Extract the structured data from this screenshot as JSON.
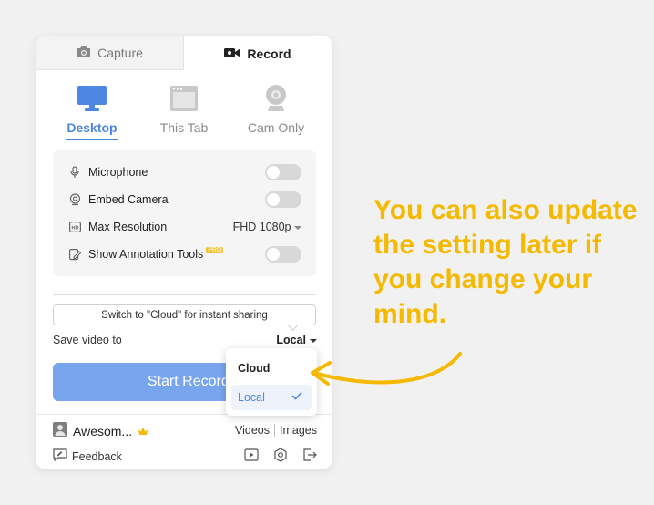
{
  "tabs": {
    "capture_label": "Capture",
    "record_label": "Record"
  },
  "modes": [
    {
      "label": "Desktop",
      "icon": "monitor-icon",
      "selected": true
    },
    {
      "label": "This Tab",
      "icon": "browser-tab-icon",
      "selected": false
    },
    {
      "label": "Cam Only",
      "icon": "webcam-icon",
      "selected": false
    }
  ],
  "options": {
    "microphone": {
      "label": "Microphone",
      "icon": "microphone-icon",
      "enabled": false
    },
    "embed_camera": {
      "label": "Embed Camera",
      "icon": "camera-icon",
      "enabled": false
    },
    "max_resolution": {
      "label": "Max Resolution",
      "icon": "hd-icon",
      "value": "FHD 1080p"
    },
    "annotation_tools": {
      "label": "Show Annotation Tools",
      "icon": "annotate-icon",
      "badge": "PRO",
      "enabled": false
    }
  },
  "tooltip": "Switch to \"Cloud\" for instant sharing",
  "save": {
    "label": "Save video to",
    "value": "Local"
  },
  "start_button": "Start Recording",
  "dropdown": {
    "options": [
      "Cloud",
      "Local"
    ],
    "selected": "Local"
  },
  "user": {
    "name": "Awesom...",
    "icon": "user-avatar-icon",
    "badge_icon": "crown-icon"
  },
  "links": {
    "videos": "Videos",
    "images": "Images"
  },
  "feedback": "Feedback",
  "annotation_text": "You can also update the setting later if you change your mind.",
  "colors": {
    "accent": "#4e86e4",
    "button": "#78a6ee",
    "annotation": "#f5b900"
  }
}
